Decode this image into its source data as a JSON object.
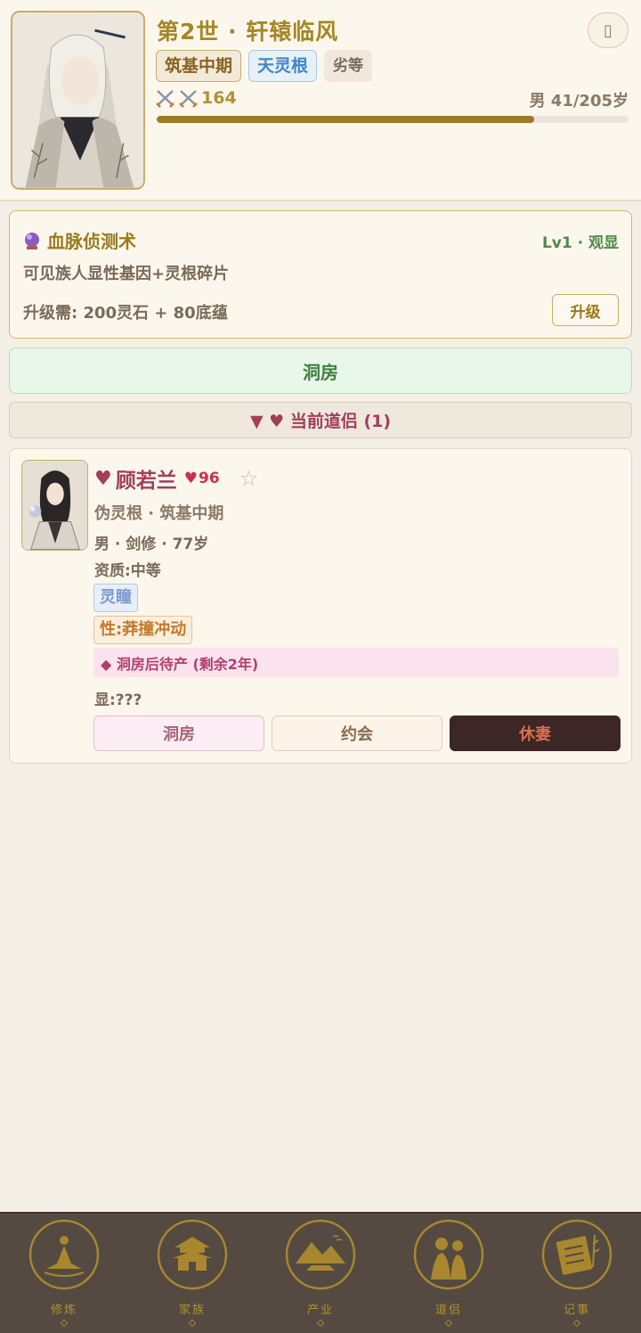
{
  "header": {
    "title": "第2世 · 轩辕临风",
    "menu_icon": "▯",
    "realm_tag": "筑基中期",
    "root_tag": "天灵根",
    "grade_tag": "劣等",
    "power_value": "164",
    "age_text": "男 41/205岁",
    "life_progress": 0.8
  },
  "skill": {
    "title": "血脉侦测术",
    "level": "Lv1 · 观显",
    "description": "可见族人显性基因+灵根碎片",
    "cost": "升级需: 200灵石 + 80底蕴",
    "upgrade_label": "升级"
  },
  "bridal_button": "洞房",
  "partner_header": "▼ ♥ 当前道侣 (1)",
  "partner": {
    "heart": "♥",
    "name": "顾若兰",
    "affection_icon": "♥",
    "affection": "96",
    "star": "☆",
    "root_realm": "伪灵根 · 筑基中期",
    "gender_class_age": "男 · 剑修 · 77岁",
    "aptitude": "资质:中等",
    "eye_tag": "灵瞳",
    "trait_tag": "性:莽撞冲动",
    "status": "◆ 洞房后待产 (剩余2年)",
    "dominant": "显:???",
    "actions": {
      "bridal": "洞房",
      "date": "约会",
      "divorce": "休妻"
    }
  },
  "nav": {
    "items": [
      {
        "label": "修炼",
        "icon": "meditation-icon"
      },
      {
        "label": "家族",
        "icon": "pavilion-icon"
      },
      {
        "label": "产业",
        "icon": "mountain-estate-icon"
      },
      {
        "label": "道侣",
        "icon": "couple-icon"
      },
      {
        "label": "记事",
        "icon": "scroll-icon"
      }
    ]
  },
  "colors": {
    "gold": "#a68624",
    "partner_red": "#a23e5a",
    "green": "#4f8a4a",
    "nav_bg": "#544a42"
  }
}
